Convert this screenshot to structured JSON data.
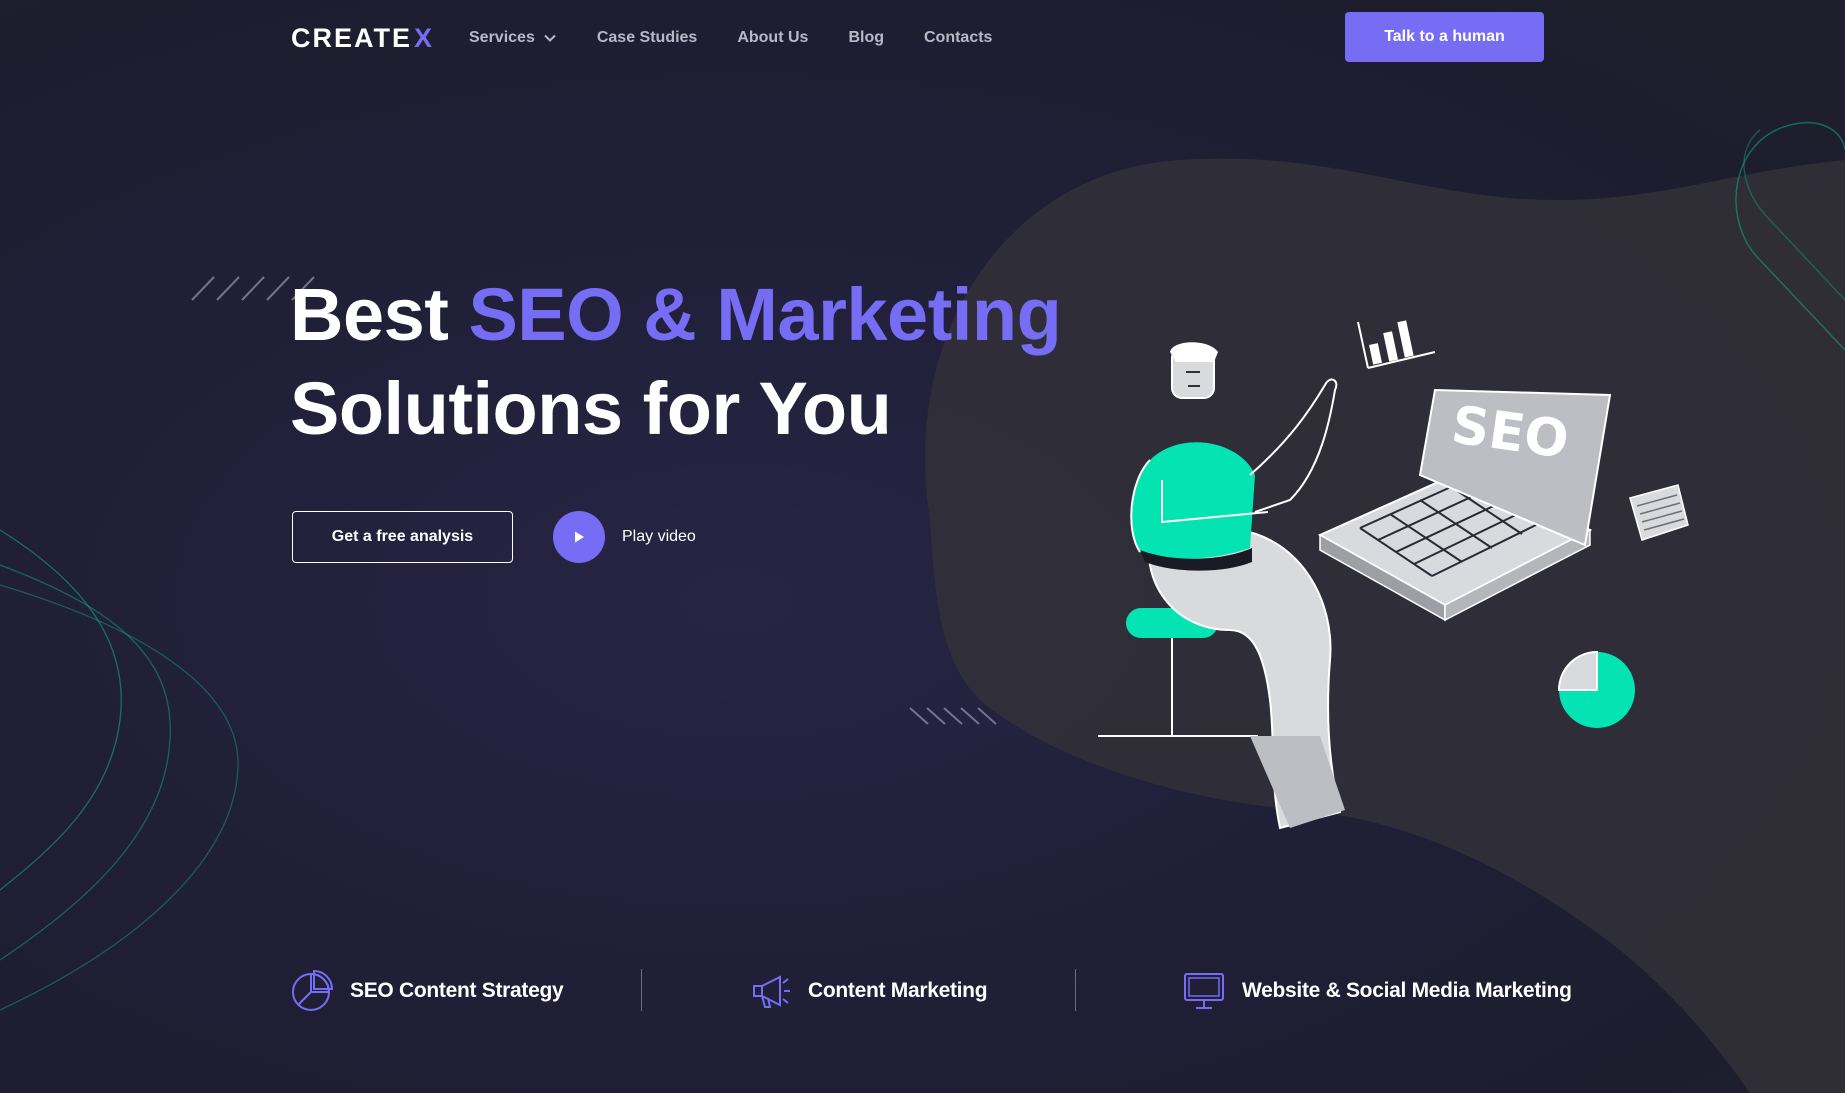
{
  "header": {
    "logo_text": "CREATE",
    "logo_accent": "X",
    "nav": [
      {
        "label": "Services",
        "has_dropdown": true
      },
      {
        "label": "Case Studies"
      },
      {
        "label": "About Us"
      },
      {
        "label": "Blog"
      },
      {
        "label": "Contacts"
      }
    ],
    "cta_label": "Talk to a human"
  },
  "hero": {
    "title_part1": "Best ",
    "title_accent": "SEO & Marketing",
    "title_line2": "Solutions for You",
    "primary_button": "Get a free analysis",
    "video_label": "Play video"
  },
  "illustration": {
    "laptop_text": "SEO"
  },
  "features": [
    {
      "icon": "pie-chart-icon",
      "label": "SEO Content Strategy"
    },
    {
      "icon": "megaphone-icon",
      "label": "Content Marketing"
    },
    {
      "icon": "monitor-icon",
      "label": "Website & Social Media Marketing"
    }
  ],
  "colors": {
    "accent": "#766df4",
    "green": "#03e4b2",
    "background": "#1f1e33",
    "nav_text": "#b9b8c8"
  }
}
